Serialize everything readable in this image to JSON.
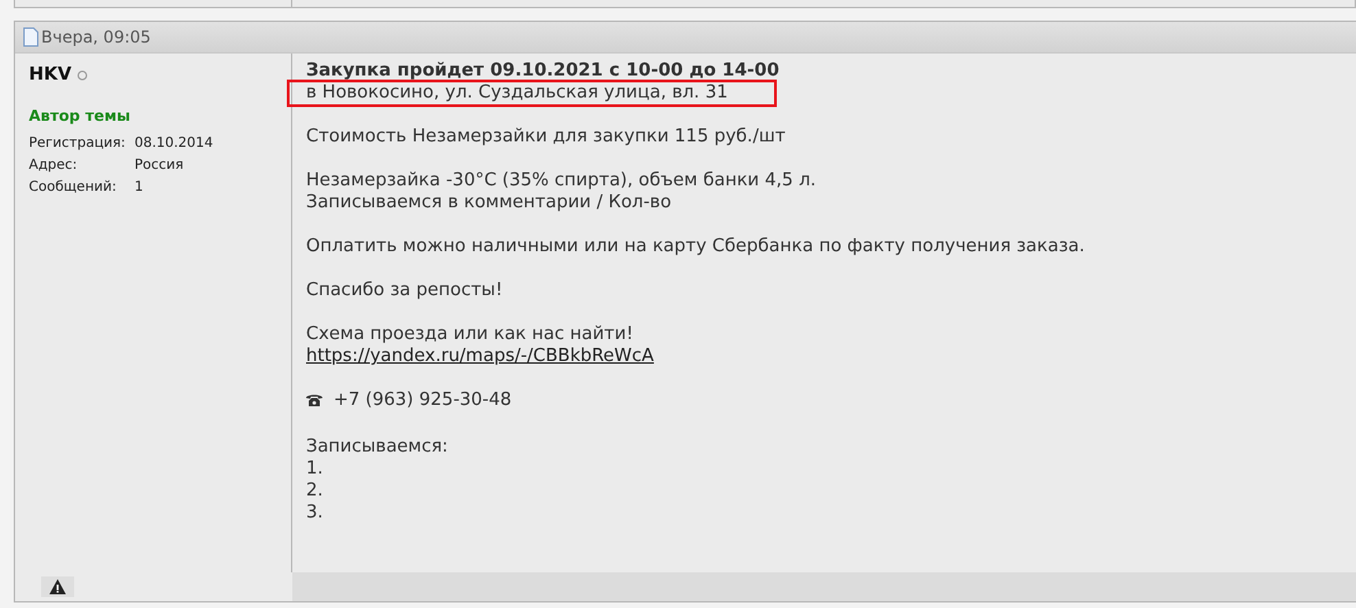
{
  "post": {
    "date": "Вчера, 09:05",
    "author": {
      "name": "HKV",
      "online": false,
      "role": "Автор темы"
    },
    "info": [
      {
        "label": "Регистрация:",
        "value": "08.10.2014"
      },
      {
        "label": "Адрес:",
        "value": "Россия"
      },
      {
        "label": "Сообщений:",
        "value": "1"
      }
    ],
    "paragraphs": [
      [
        {
          "kind": "heading",
          "text": "Закупка пройдет 09.10.2021 с 10-00 до 14-00",
          "highlighted": false
        },
        {
          "kind": "text",
          "text": "в Новокосино, ул. Суздальская улица, вл. 31",
          "highlighted": true
        }
      ],
      [
        {
          "kind": "text",
          "text": "Стоимость Незамерзайки для закупки 115 руб./шт",
          "highlighted": false
        }
      ],
      [
        {
          "kind": "text",
          "text": "Незамерзайка -30°С (35% спирта), объем банки 4,5 л.",
          "highlighted": false
        },
        {
          "kind": "text",
          "text": "Записываемся в комментарии / Кол-во",
          "highlighted": false
        }
      ],
      [
        {
          "kind": "text",
          "text": "Оплатить можно наличными или на карту Сбербанка по факту получения заказа.",
          "highlighted": false
        }
      ],
      [
        {
          "kind": "text",
          "text": "Спасибо за репосты!",
          "highlighted": false
        }
      ],
      [
        {
          "kind": "text",
          "text": "Схема проезда или как нас найти!",
          "highlighted": false
        },
        {
          "kind": "link",
          "text": "https://yandex.ru/maps/-/CBBkbReWcA",
          "highlighted": false
        }
      ],
      [
        {
          "kind": "phone",
          "text": "+7 (963) 925-30-48",
          "highlighted": false
        }
      ],
      [
        {
          "kind": "text",
          "text": "Записываемся:",
          "highlighted": false
        },
        {
          "kind": "text",
          "text": "1.",
          "highlighted": false
        },
        {
          "kind": "text",
          "text": "2.",
          "highlighted": false
        },
        {
          "kind": "text",
          "text": "3.",
          "highlighted": false
        }
      ]
    ]
  }
}
